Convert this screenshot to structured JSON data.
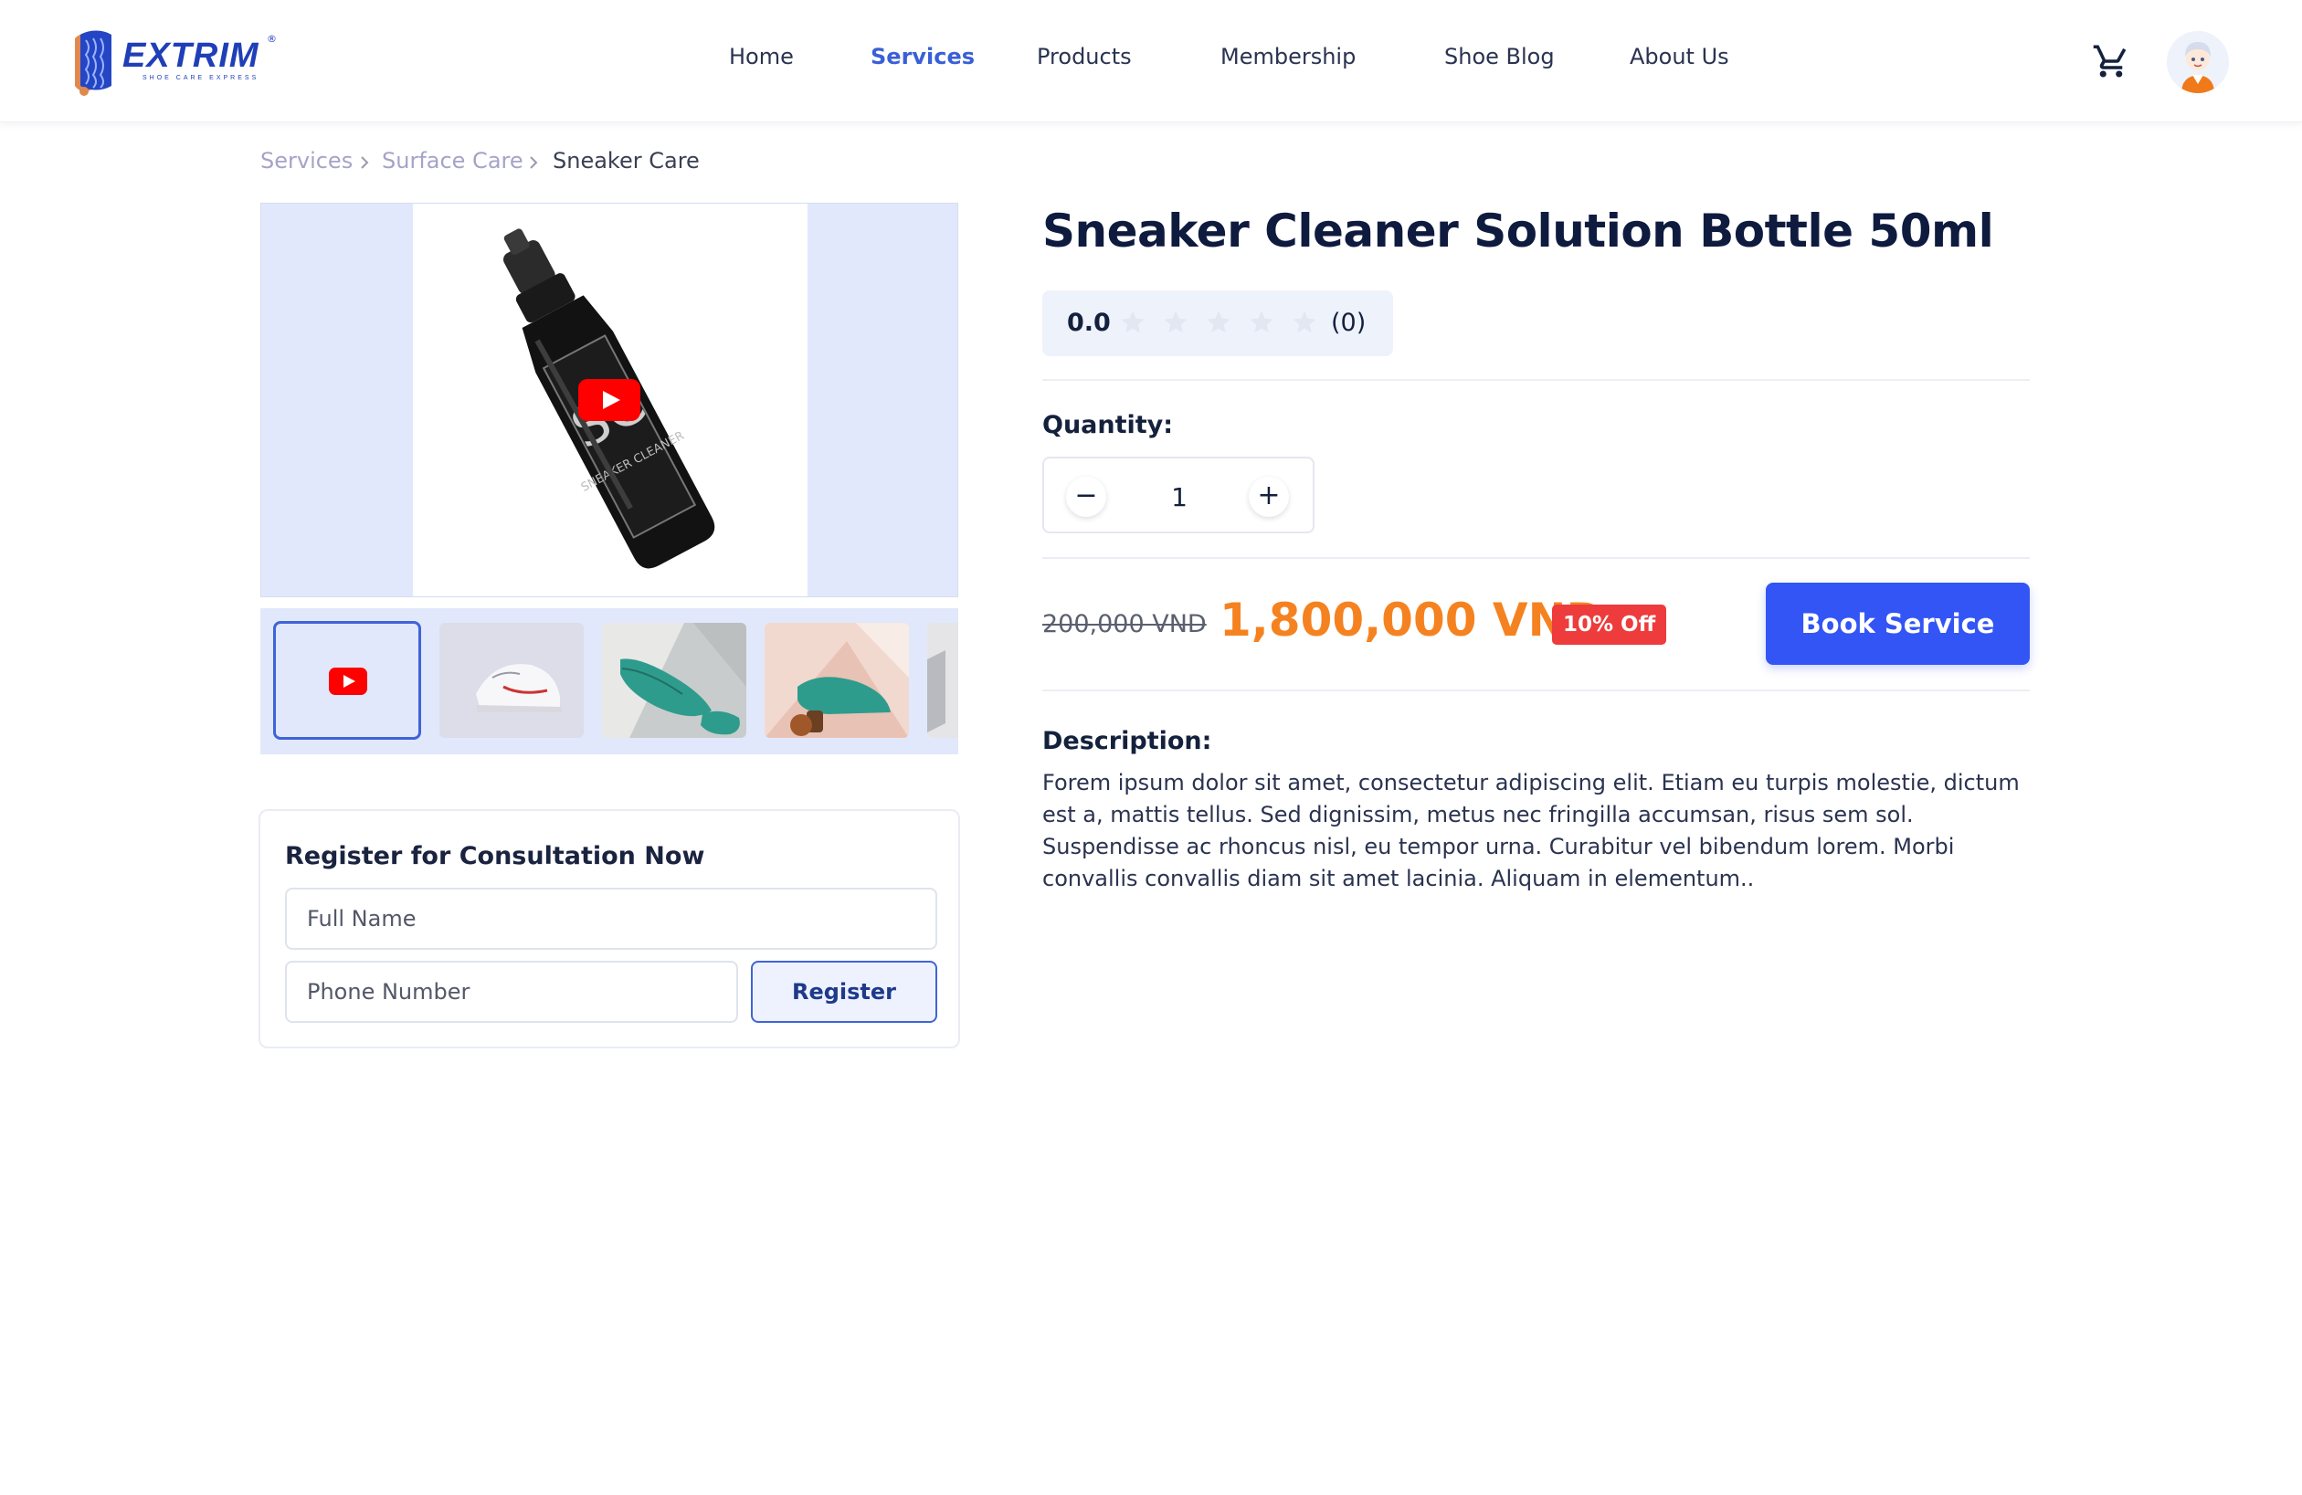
{
  "brand": {
    "name": "EXTRIM",
    "tagline": "SHOE CARE EXPRESS",
    "primary_color": "#3355f5",
    "accent_color": "#f58220"
  },
  "nav": {
    "items": [
      {
        "label": "Home",
        "active": false
      },
      {
        "label": "Services",
        "active": true
      },
      {
        "label": "Products",
        "active": false
      },
      {
        "label": "Membership",
        "active": false
      },
      {
        "label": "Shoe Blog",
        "active": false
      },
      {
        "label": "About Us",
        "active": false
      }
    ],
    "icons": [
      "cart-icon",
      "avatar"
    ]
  },
  "breadcrumb": [
    "Services",
    "Surface Care",
    "Sneaker Care"
  ],
  "gallery": {
    "main_media": "video",
    "thumbnails": [
      "video",
      "white-sneakers",
      "teal-shoes",
      "teal-heel-shoe",
      "partial-thumbnail"
    ]
  },
  "consultation": {
    "title": "Register for Consultation Now",
    "name_placeholder": "Full Name",
    "phone_placeholder": "Phone Number",
    "button_label": "Register"
  },
  "product": {
    "title": "Sneaker Cleaner Solution Bottle 50ml",
    "rating": {
      "score": "0.0",
      "stars_filled": 0,
      "stars_total": 5,
      "count": "(0)"
    },
    "quantity_label": "Quantity:",
    "quantity": "1",
    "old_price": "200,000 VND",
    "price": "1,800,000 VND",
    "discount": "10% Off",
    "book_label": "Book Service",
    "description_label": "Description:",
    "description": "Forem ipsum dolor sit amet, consectetur adipiscing elit. Etiam eu turpis molestie, dictum est a, mattis tellus. Sed dignissim, metus nec fringilla accumsan, risus sem sol. Suspendisse ac rhoncus nisl, eu tempor urna. Curabitur vel bibendum lorem. Morbi convallis convallis diam sit amet lacinia. Aliquam in elementum.."
  }
}
